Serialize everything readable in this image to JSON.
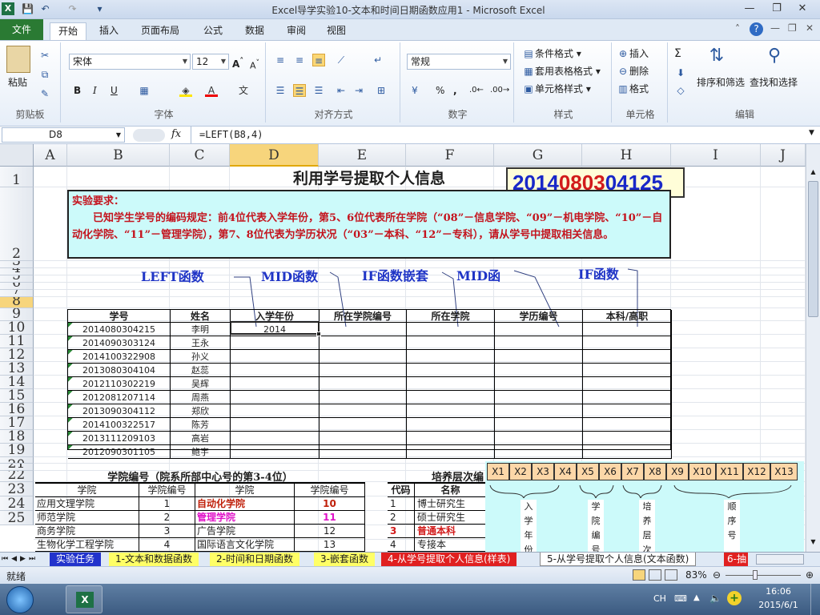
{
  "window": {
    "title": "Excel导学实验10-文本和时间日期函数应用1  -  Microsoft Excel"
  },
  "quick_access": {
    "save": "💾",
    "undo": "↶",
    "redo": "↷",
    "customize": "▾"
  },
  "ribbon_tabs": [
    "文件",
    "开始",
    "插入",
    "页面布局",
    "公式",
    "数据",
    "审阅",
    "视图"
  ],
  "ribbon": {
    "clipboard": {
      "label": "剪贴板",
      "paste": "粘贴"
    },
    "font": {
      "label": "字体",
      "name": "宋体",
      "size": "12",
      "bold": "B",
      "italic": "I",
      "underline": "U"
    },
    "alignment": {
      "label": "对齐方式"
    },
    "number": {
      "label": "数字",
      "format": "常规",
      "percent": "%",
      "comma": ","
    },
    "styles": {
      "label": "样式",
      "conditional": "条件格式",
      "table": "套用表格格式",
      "cell": "单元格样式"
    },
    "cells": {
      "label": "单元格",
      "insert": "插入",
      "delete": "删除",
      "format": "格式"
    },
    "editing": {
      "label": "编辑",
      "sum": "Σ",
      "sort": "排序和筛选",
      "find": "查找和选择"
    }
  },
  "formula_bar": {
    "name_box": "D8",
    "fx": "fx",
    "formula": "=LEFT(B8,4)"
  },
  "columns": [
    "A",
    "B",
    "C",
    "D",
    "E",
    "F",
    "G",
    "H",
    "I",
    "J"
  ],
  "rows": [
    "1",
    "2",
    "3",
    "4",
    "5",
    "6",
    "7",
    "8",
    "9",
    "10",
    "11",
    "12",
    "13",
    "14",
    "15",
    "16",
    "17",
    "18",
    "19",
    "20",
    "21",
    "22",
    "23",
    "24",
    "25"
  ],
  "sheet": {
    "title": "利用学号提取个人信息",
    "id_prefix1": "2014",
    "id_mid": "0803",
    "id_suffix": "04125",
    "req_heading": "实验要求：",
    "req_text": "　　已知学生学号的编码规定：前4位代表入学年份，第5、6位代表所在学院（“08”－信息学院、“09”－机电学院、“10”－自动化学院、“11”－管理学院），第7、8位代表为学历状况（“03”－本科、“12”－专科），请从学号中提取相关信息。",
    "labels": [
      "LEFT函数",
      "MID函数",
      "IF函数嵌套",
      "MID函",
      "IF函数"
    ],
    "table_headers": [
      "学号",
      "姓名",
      "入学年份",
      "所在学院编号",
      "所在学院",
      "学历编号",
      "本科/高职"
    ],
    "students": [
      {
        "id": "2014080304215",
        "name": "李明",
        "year": "2014"
      },
      {
        "id": "2014090303124",
        "name": "王永",
        "year": ""
      },
      {
        "id": "2014100322908",
        "name": "孙义",
        "year": ""
      },
      {
        "id": "2013080304104",
        "name": "赵蕊",
        "year": ""
      },
      {
        "id": "2012110302219",
        "name": "吴辉",
        "year": ""
      },
      {
        "id": "2012081207114",
        "name": "周燕",
        "year": ""
      },
      {
        "id": "2013090304112",
        "name": "郑欣",
        "year": ""
      },
      {
        "id": "2014100322517",
        "name": "陈芳",
        "year": ""
      },
      {
        "id": "2013111209103",
        "name": "高岩",
        "year": ""
      },
      {
        "id": "2012090301105",
        "name": "鲍宇",
        "year": ""
      }
    ],
    "college_table": {
      "title": "学院编号（院系所部中心号的第3-4位）",
      "headers": [
        "学院",
        "学院编号",
        "学院",
        "学院编号"
      ],
      "rows": [
        [
          "应用文理学院",
          "1",
          "自动化学院",
          "10"
        ],
        [
          "师范学院",
          "2",
          "管理学院",
          "11"
        ],
        [
          "商务学院",
          "3",
          "广告学院",
          "12"
        ],
        [
          "生物化学工程学院",
          "4",
          "国际语言文化学院",
          "13"
        ]
      ]
    },
    "level_table": {
      "title": "培养层次编",
      "headers": [
        "代码",
        "名称"
      ],
      "rows": [
        [
          "1",
          "博士研究生"
        ],
        [
          "2",
          "硕士研究生"
        ],
        [
          "3",
          "普通本科"
        ],
        [
          "4",
          "专接本"
        ]
      ]
    },
    "diagram": {
      "boxes": [
        "X1",
        "X2",
        "X3",
        "X4",
        "X5",
        "X6",
        "X7",
        "X8",
        "X9",
        "X10",
        "X11",
        "X12",
        "X13"
      ],
      "groups": [
        "入学年份",
        "学院编号",
        "培养层次",
        "顺序号"
      ]
    }
  },
  "sheet_tabs": [
    "实验任务",
    "1-文本和数据函数",
    "2-时间和日期函数",
    "3-嵌套函数",
    "4-从学号提取个人信息(样表)",
    "5-从学号提取个人信息(文本函数)",
    "6-抽"
  ],
  "status": {
    "ready": "就绪",
    "zoom": "83%"
  },
  "taskbar": {
    "lang": "CH",
    "time": "16:06",
    "date": "2015/6/1"
  },
  "colors": {
    "accent": "#2a7a33",
    "selected": "#f7d57c",
    "cyan": "#ccfafa",
    "orange": "#fcd7a8"
  }
}
